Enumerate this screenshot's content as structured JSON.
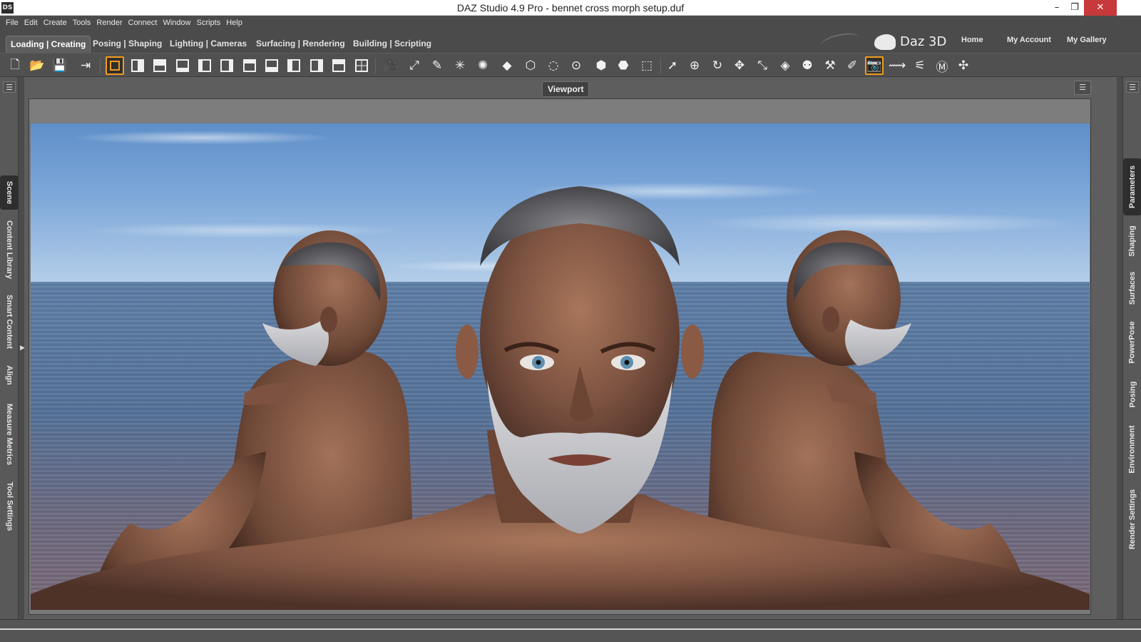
{
  "window": {
    "title": "DAZ Studio 4.9 Pro - bennet cross morph setup.duf",
    "app_icon": "DS",
    "minimize": "–",
    "restore": "❐",
    "close": "✕"
  },
  "menu": [
    "File",
    "Edit",
    "Create",
    "Tools",
    "Render",
    "Connect",
    "Window",
    "Scripts",
    "Help"
  ],
  "activity_tabs": [
    "Loading | Creating",
    "Posing | Shaping",
    "Lighting | Cameras",
    "Surfacing | Rendering",
    "Building | Scripting"
  ],
  "brand": {
    "logo_text": "Daz 3D"
  },
  "header_links": [
    "Home",
    "My Account",
    "My Gallery"
  ],
  "viewport": {
    "tab_label": "Viewport",
    "menu_glyph": "☰"
  },
  "left_panel_tabs": [
    "Scene",
    "Content Library",
    "Smart Content",
    "Align",
    "Measure Metrics",
    "Tool Settings"
  ],
  "right_panel_tabs": [
    "Parameters",
    "Shaping",
    "Surfaces",
    "PowerPose",
    "Posing",
    "Environment",
    "Render Settings"
  ],
  "panel_menu_glyph": "☰",
  "left_arrow": "▶",
  "right_arrow": "◀",
  "colors": {
    "accent": "#f29b1d",
    "ui_bg": "#4b4b4b",
    "close_btn": "#c7393a"
  }
}
